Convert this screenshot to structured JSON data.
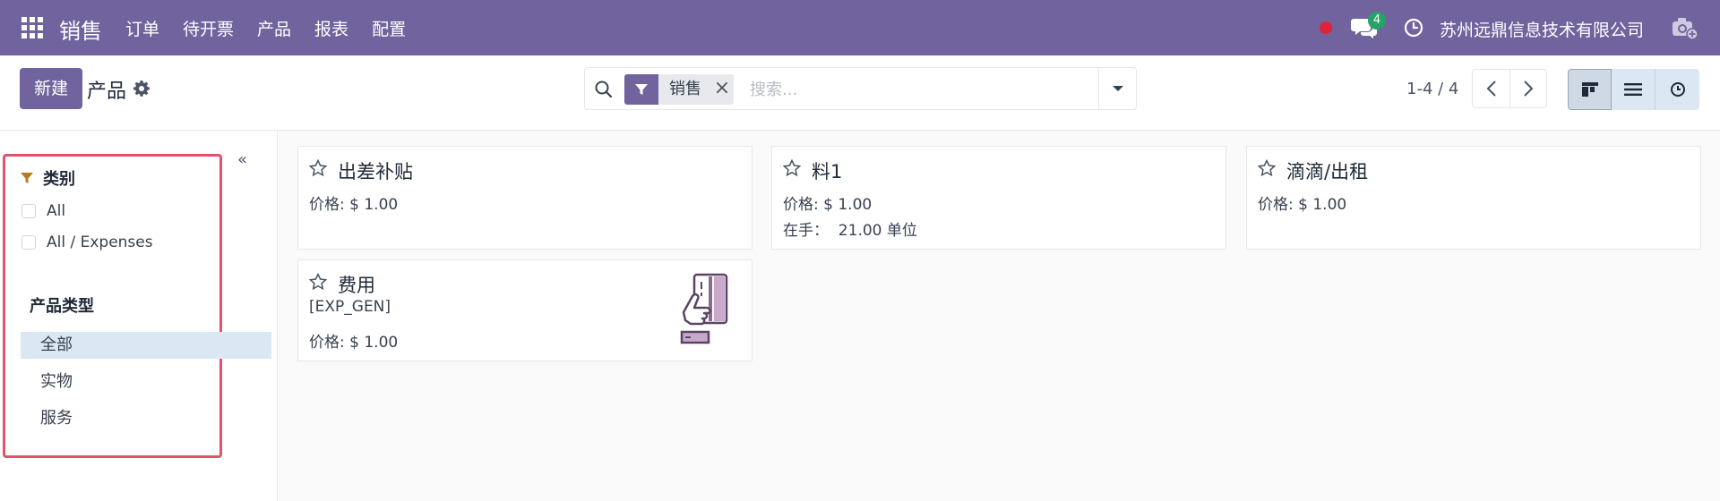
{
  "navbar": {
    "brand": "销售",
    "menu": [
      "订单",
      "待开票",
      "产品",
      "报表",
      "配置"
    ],
    "chat_count": "4",
    "company": "苏州远鼎信息技术有限公司"
  },
  "control": {
    "new_label": "新建",
    "title": "产品",
    "facet_label": "销售",
    "search_placeholder": "搜索...",
    "pager": "1-4 / 4"
  },
  "sidebar": {
    "category_header": "类别",
    "categories": [
      "All",
      "All / Expenses"
    ],
    "type_header": "产品类型",
    "types": [
      "全部",
      "实物",
      "服务"
    ],
    "active_type": "全部"
  },
  "cards": [
    {
      "title": "出差补贴",
      "lines": [
        "价格: $ 1.00"
      ]
    },
    {
      "title": "料1",
      "lines": [
        "价格: $ 1.00",
        "在手：  21.00 单位"
      ]
    },
    {
      "title": "滴滴/出租",
      "lines": [
        "价格: $ 1.00"
      ]
    },
    {
      "title": "费用",
      "lines": [
        "[EXP_GEN]",
        "价格: $ 1.00"
      ],
      "image": "credit-card-hand-icon"
    }
  ],
  "colors": {
    "brand": "#71639e",
    "badge": "#26a269",
    "highlight_border": "#e05469",
    "active_bg": "#dbe7f2"
  }
}
